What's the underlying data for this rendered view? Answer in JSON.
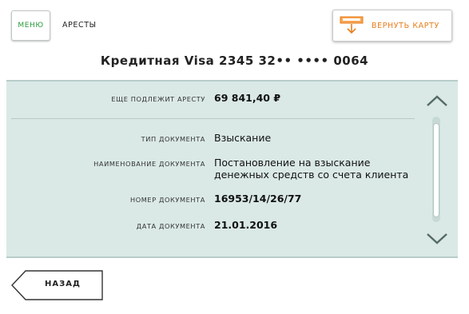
{
  "header": {
    "menu_label": "МЕНЮ",
    "section_title": "АРЕСТЫ",
    "return_card_label": "ВЕРНУТЬ КАРТУ",
    "return_card_icon": "card-eject-icon"
  },
  "card": {
    "title": "Кредитная Visa 2345 32•• •••• 0064"
  },
  "details": {
    "remaining_label": "ЕЩЕ ПОДЛЕЖИТ АРЕСТУ",
    "remaining_value": "69 841,40 ₽",
    "doc_type_label": "ТИП ДОКУМЕНТА",
    "doc_type_value": "Взыскание",
    "doc_name_label": "НАИМЕНОВАНИЕ ДОКУМЕНТА",
    "doc_name_line1": "Постановление на взыскание",
    "doc_name_line2": "денежных средств со счета клиента",
    "doc_number_label": "НОМЕР ДОКУМЕНТА",
    "doc_number_value": "16953/14/26/77",
    "doc_date_label": "ДАТА ДОКУМЕНТА",
    "doc_date_value": "21.01.2016"
  },
  "footer": {
    "back_label": "НАЗАД"
  },
  "colors": {
    "accent_green": "#2a9a3a",
    "accent_orange": "#e87e1c",
    "panel_bg": "#dae9e6"
  }
}
